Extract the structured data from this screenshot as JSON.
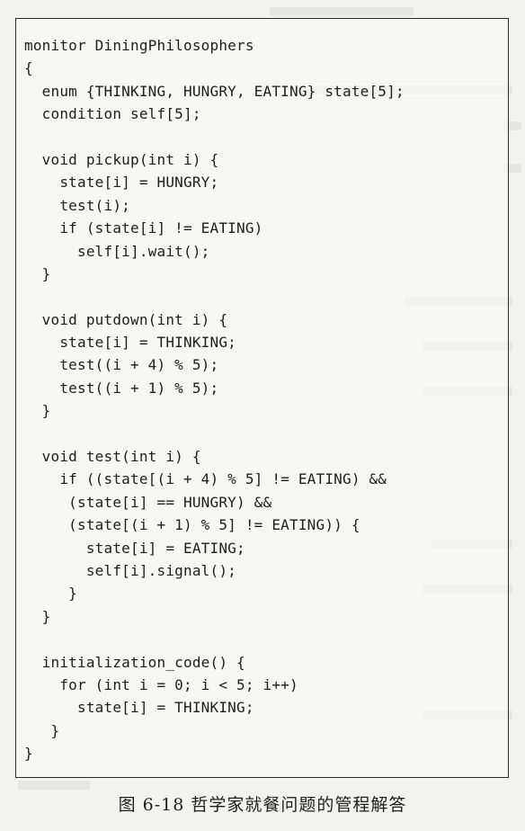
{
  "figure": {
    "code_lines": [
      "monitor DiningPhilosophers",
      "{",
      "  enum {THINKING, HUNGRY, EATING} state[5];",
      "  condition self[5];",
      "",
      "  void pickup(int i) {",
      "    state[i] = HUNGRY;",
      "    test(i);",
      "    if (state[i] != EATING)",
      "      self[i].wait();",
      "  }",
      "",
      "  void putdown(int i) {",
      "    state[i] = THINKING;",
      "    test((i + 4) % 5);",
      "    test((i + 1) % 5);",
      "  }",
      "",
      "  void test(int i) {",
      "    if ((state[(i + 4) % 5] != EATING) &&",
      "     (state[i] == HUNGRY) &&",
      "     (state[(i + 1) % 5] != EATING)) {",
      "       state[i] = EATING;",
      "       self[i].signal();",
      "     }",
      "  }",
      "",
      "  initialization_code() {",
      "    for (int i = 0; i < 5; i++)",
      "      state[i] = THINKING;",
      "   }",
      "}"
    ],
    "caption": "图 6-18   哲学家就餐问题的管程解答"
  }
}
